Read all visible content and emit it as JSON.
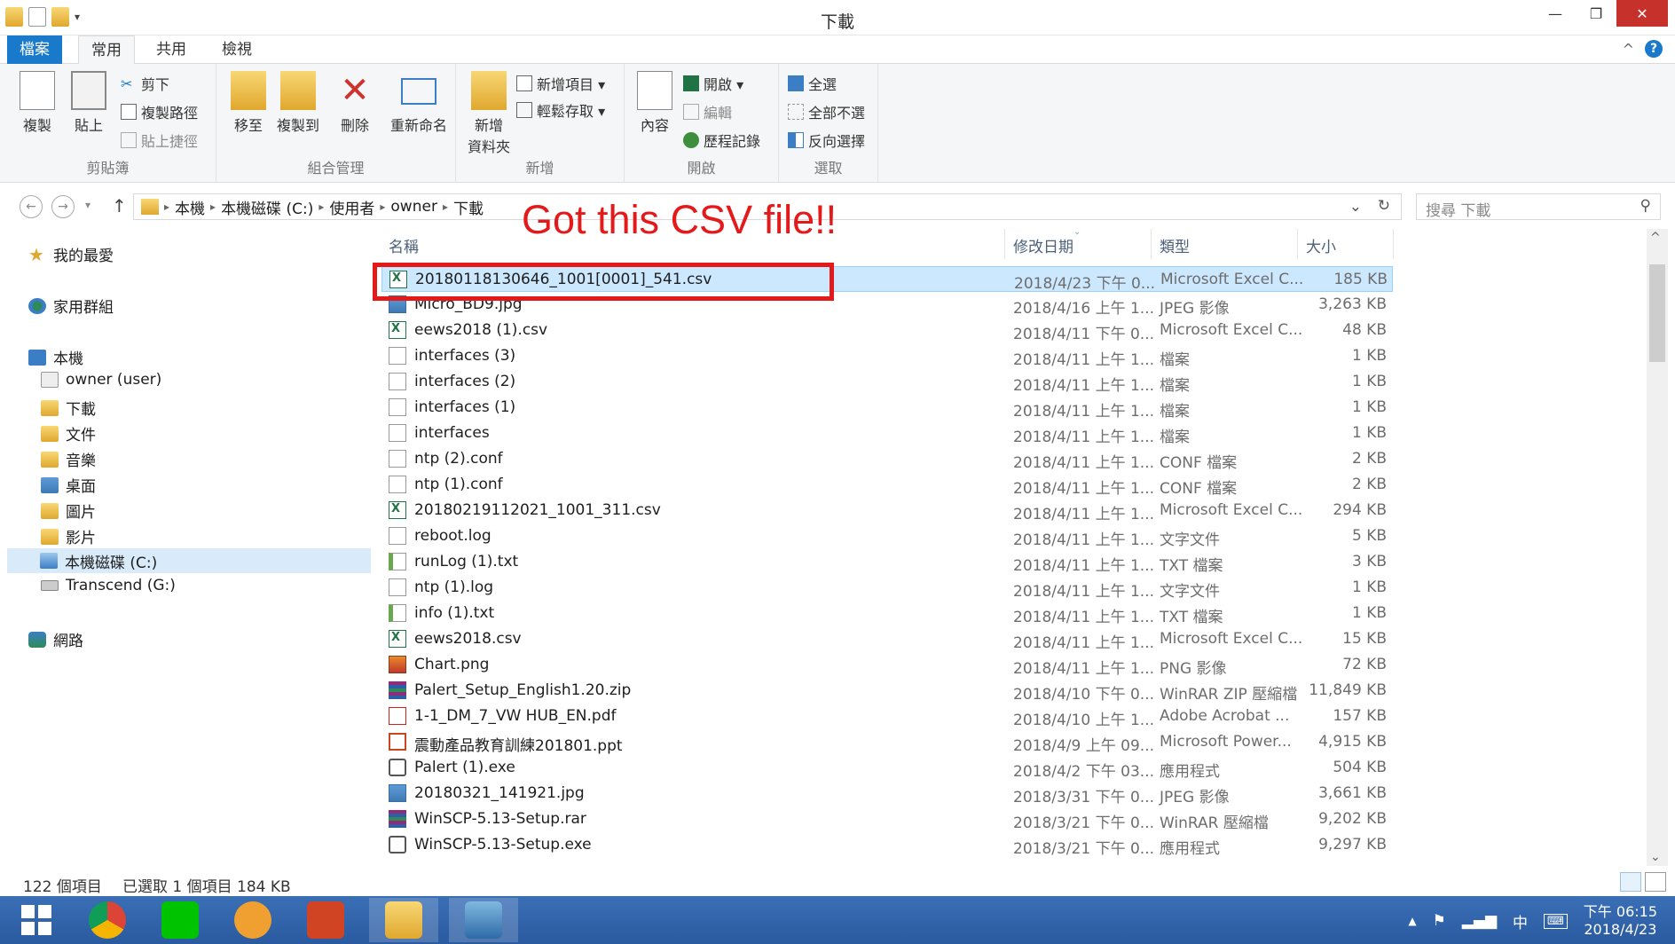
{
  "window": {
    "title": "下載"
  },
  "tabs": {
    "file": "檔案",
    "home": "常用",
    "share": "共用",
    "view": "檢視"
  },
  "ribbon": {
    "clipboard": {
      "label": "剪貼簿",
      "copy": "複製",
      "paste": "貼上",
      "cut": "剪下",
      "copy_path": "複製路徑",
      "paste_shortcut": "貼上捷徑"
    },
    "organize": {
      "label": "組合管理",
      "move_to": "移至",
      "copy_to": "複製到",
      "delete": "刪除",
      "rename": "重新命名"
    },
    "new": {
      "label": "新增",
      "new_folder_line1": "新增",
      "new_folder_line2": "資料夾",
      "new_item": "新增項目 ▾",
      "easy_access": "輕鬆存取 ▾"
    },
    "open": {
      "label": "開啟",
      "properties": "內容",
      "open": "開啟 ▾",
      "edit": "編輯",
      "history": "歷程記錄"
    },
    "select": {
      "label": "選取",
      "select_all": "全選",
      "select_none": "全部不選",
      "invert": "反向選擇"
    }
  },
  "address": {
    "crumbs": [
      "本機",
      "本機磁碟 (C:)",
      "使用者",
      "owner",
      "下載"
    ],
    "search_placeholder": "搜尋 下載"
  },
  "navpane": {
    "favorites": "我的最愛",
    "homegroup": "家用群組",
    "this_pc": "本機",
    "owner": "owner (user)",
    "downloads": "下載",
    "documents": "文件",
    "music": "音樂",
    "desktop": "桌面",
    "pictures": "圖片",
    "videos": "影片",
    "local_disk": "本機磁碟 (C:)",
    "transcend": "Transcend (G:)",
    "network": "網路"
  },
  "columns": {
    "name": "名稱",
    "date": "修改日期",
    "type": "類型",
    "size": "大小"
  },
  "files": [
    {
      "name": "20180118130646_1001[0001]_541.csv",
      "date": "2018/4/23 下午 0...",
      "type": "Microsoft Excel C...",
      "size": "185 KB",
      "icon": "csv",
      "selected": true
    },
    {
      "name": "Micro_BD9.jpg",
      "date": "2018/4/16 上午 1...",
      "type": "JPEG 影像",
      "size": "3,263 KB",
      "icon": "jpg"
    },
    {
      "name": "eews2018 (1).csv",
      "date": "2018/4/11 下午 0...",
      "type": "Microsoft Excel C...",
      "size": "48 KB",
      "icon": "csv"
    },
    {
      "name": "interfaces (3)",
      "date": "2018/4/11 上午 1...",
      "type": "檔案",
      "size": "1 KB",
      "icon": "doc"
    },
    {
      "name": "interfaces (2)",
      "date": "2018/4/11 上午 1...",
      "type": "檔案",
      "size": "1 KB",
      "icon": "doc"
    },
    {
      "name": "interfaces (1)",
      "date": "2018/4/11 上午 1...",
      "type": "檔案",
      "size": "1 KB",
      "icon": "doc"
    },
    {
      "name": "interfaces",
      "date": "2018/4/11 上午 1...",
      "type": "檔案",
      "size": "1 KB",
      "icon": "doc"
    },
    {
      "name": "ntp (2).conf",
      "date": "2018/4/11 上午 1...",
      "type": "CONF 檔案",
      "size": "2 KB",
      "icon": "doc"
    },
    {
      "name": "ntp (1).conf",
      "date": "2018/4/11 上午 1...",
      "type": "CONF 檔案",
      "size": "2 KB",
      "icon": "doc"
    },
    {
      "name": "20180219112021_1001_311.csv",
      "date": "2018/4/11 上午 1...",
      "type": "Microsoft Excel C...",
      "size": "294 KB",
      "icon": "csv"
    },
    {
      "name": "reboot.log",
      "date": "2018/4/11 上午 1...",
      "type": "文字文件",
      "size": "5 KB",
      "icon": "doc"
    },
    {
      "name": "runLog (1).txt",
      "date": "2018/4/11 上午 1...",
      "type": "TXT 檔案",
      "size": "3 KB",
      "icon": "txt"
    },
    {
      "name": "ntp (1).log",
      "date": "2018/4/11 上午 1...",
      "type": "文字文件",
      "size": "1 KB",
      "icon": "doc"
    },
    {
      "name": "info (1).txt",
      "date": "2018/4/11 上午 1...",
      "type": "TXT 檔案",
      "size": "1 KB",
      "icon": "txt"
    },
    {
      "name": "eews2018.csv",
      "date": "2018/4/11 上午 1...",
      "type": "Microsoft Excel C...",
      "size": "15 KB",
      "icon": "csv"
    },
    {
      "name": "Chart.png",
      "date": "2018/4/11 上午 1...",
      "type": "PNG 影像",
      "size": "72 KB",
      "icon": "png"
    },
    {
      "name": "Palert_Setup_English1.20.zip",
      "date": "2018/4/10 下午 0...",
      "type": "WinRAR ZIP 壓縮檔",
      "size": "11,849 KB",
      "icon": "zip"
    },
    {
      "name": "1-1_DM_7_VW HUB_EN.pdf",
      "date": "2018/4/10 上午 1...",
      "type": "Adobe Acrobat ...",
      "size": "157 KB",
      "icon": "pdf"
    },
    {
      "name": "震動產品教育訓練201801.ppt",
      "date": "2018/4/9 上午 09...",
      "type": "Microsoft Power...",
      "size": "4,915 KB",
      "icon": "ppt"
    },
    {
      "name": "Palert (1).exe",
      "date": "2018/4/2 下午 03...",
      "type": "應用程式",
      "size": "504 KB",
      "icon": "exe"
    },
    {
      "name": "20180321_141921.jpg",
      "date": "2018/3/31 下午 0...",
      "type": "JPEG 影像",
      "size": "3,661 KB",
      "icon": "jpg"
    },
    {
      "name": "WinSCP-5.13-Setup.rar",
      "date": "2018/3/21 下午 0...",
      "type": "WinRAR 壓縮檔",
      "size": "9,202 KB",
      "icon": "zip"
    },
    {
      "name": "WinSCP-5.13-Setup.exe",
      "date": "2018/3/21 下午 0...",
      "type": "應用程式",
      "size": "9,297 KB",
      "icon": "exe"
    }
  ],
  "annotation": {
    "text": "Got this CSV file!!"
  },
  "status": {
    "count": "122 個項目",
    "selected": "已選取 1 個項目 184 KB"
  },
  "taskbar": {
    "ime": "中",
    "time": "下午 06:15",
    "date": "2018/4/23"
  },
  "colors": {
    "accent": "#1979ca",
    "annotation": "#e41a1a",
    "selection": "#cce8ff",
    "taskbar": "#2a5aa0"
  }
}
